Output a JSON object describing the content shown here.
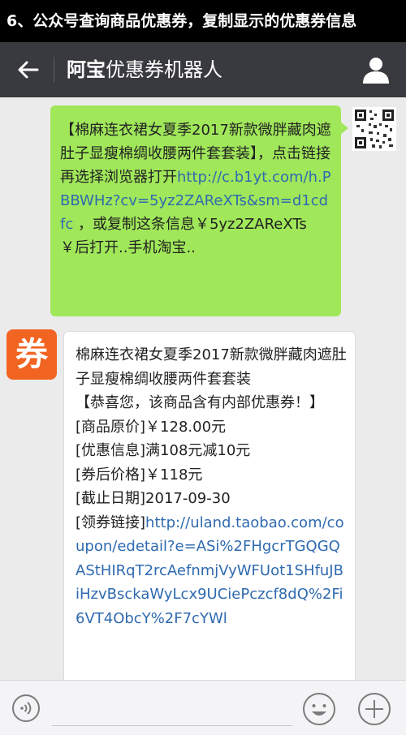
{
  "banner": {
    "text": "6、公众号查询商品优惠券，复制显示的优惠券信息"
  },
  "nav": {
    "title_bold": "阿宝",
    "title_rest": "优惠券机器人"
  },
  "sent_message": {
    "text_before_link": "【棉麻连衣裙女夏季2017新款微胖藏肉遮肚子显瘦棉绸收腰两件套套装】，点击链接再选择浏览器打开",
    "link": "http://c.b1yt.com/h.PBBWHz?cv=5yz2ZAReXTs&sm=d1cdfc",
    "text_after_link": " ，或复制这条信息￥5yz2ZAReXTs￥后打开..手机淘宝.."
  },
  "coupon_avatar": {
    "glyph": "券"
  },
  "received_message": {
    "product": "棉麻连衣裙女夏季2017新款微胖藏肉遮肚子显瘦棉绸收腰两件套套装",
    "notice": "【恭喜您，该商品含有内部优惠券！】",
    "original_price": "[商品原价]￥128.00元",
    "discount_info": "[优惠信息]满108元减10元",
    "final_price": "[券后价格]￥118元",
    "deadline": "[截止日期]2017-09-30",
    "coupon_link_label": "[领券链接]",
    "coupon_link": "http://uland.taobao.com/coupon/edetail?e=ASi%2FHgcrTGQGQAStHIRqT2rcAefnmjVyWFUot1SHfuJBiHzvBsckaWyLcx9UCiePczcf8dQ%2Fi6VT4ObcY%2F7cYWl"
  },
  "icons": {
    "back": "arrow-left-icon",
    "profile": "person-icon",
    "voice": "voice-icon",
    "emoji": "smiley-icon",
    "plus": "plus-icon",
    "qr": "qr-code-icon"
  }
}
